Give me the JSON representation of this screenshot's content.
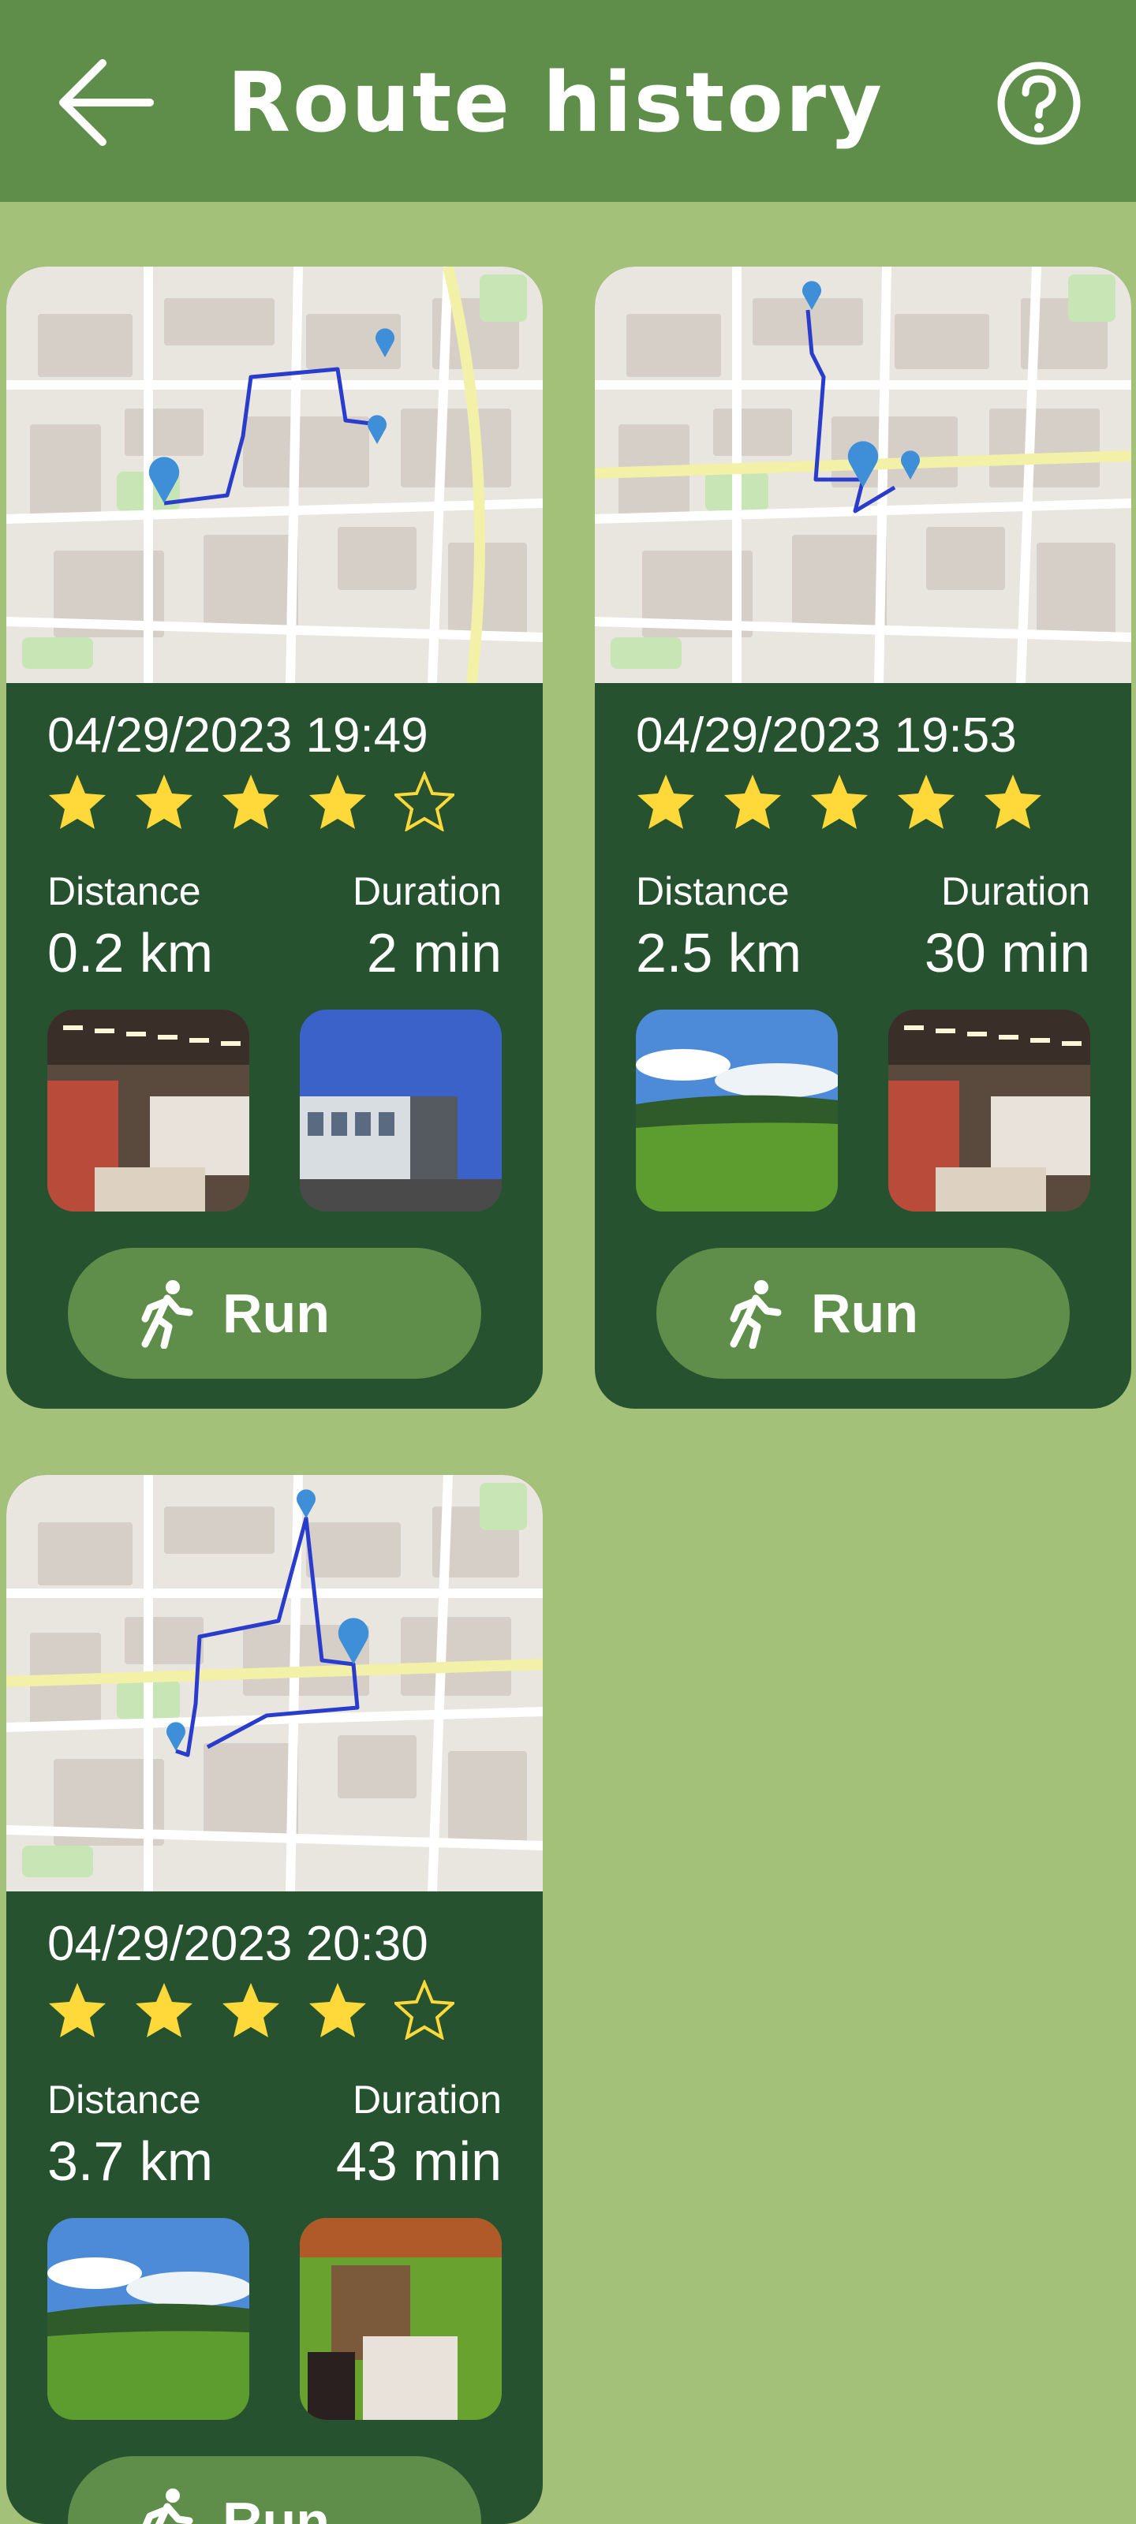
{
  "header": {
    "title": "Route history",
    "back_icon": "arrow-left-icon",
    "help_icon": "help-circle-icon"
  },
  "labels": {
    "distance": "Distance",
    "duration": "Duration",
    "run": "Run"
  },
  "colors": {
    "header": "#5f8e4a",
    "background": "#a3c178",
    "card": "#265230",
    "star": "#ffd93a",
    "route": "#2a3ccc"
  },
  "routes": [
    {
      "date": "04/29/2023 19:49",
      "rating": 4,
      "distance": "0.2 km",
      "duration": "2 min",
      "photos": [
        "supermarket-photo",
        "building-photo"
      ]
    },
    {
      "date": "04/29/2023 19:53",
      "rating": 5,
      "distance": "2.5 km",
      "duration": "30 min",
      "photos": [
        "meadow-photo",
        "supermarket-photo"
      ]
    },
    {
      "date": "04/29/2023 20:30",
      "rating": 4,
      "distance": "3.7 km",
      "duration": "43 min",
      "photos": [
        "meadow-photo",
        "cafe-photo"
      ]
    }
  ]
}
